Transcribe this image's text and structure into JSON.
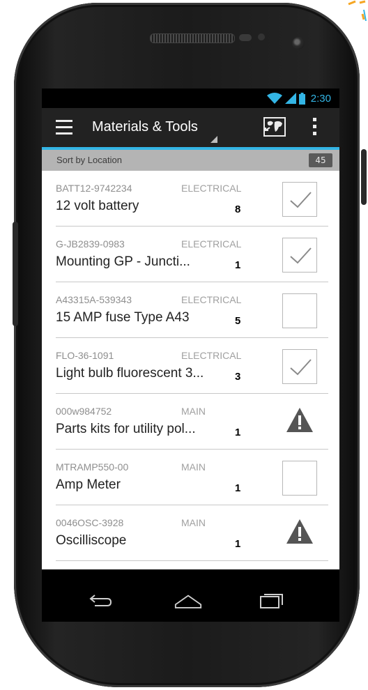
{
  "status_bar": {
    "time": "2:30",
    "icons": [
      "wifi-icon",
      "signal-icon",
      "battery-icon"
    ]
  },
  "action_bar": {
    "title": "Materials & Tools",
    "icons": [
      "menu-icon",
      "map-icon",
      "overflow-menu-icon"
    ]
  },
  "sort_bar": {
    "label": "Sort by Location",
    "count": "45"
  },
  "items": [
    {
      "code": "BATT12-9742234",
      "category": "ELECTRICAL",
      "name": "12 volt battery",
      "qty": "8",
      "status": "checked"
    },
    {
      "code": "G-JB2839-0983",
      "category": "ELECTRICAL",
      "name": "Mounting GP - Juncti...",
      "qty": "1",
      "status": "checked"
    },
    {
      "code": "A43315A-539343",
      "category": "ELECTRICAL",
      "name": "15 AMP fuse Type A43",
      "qty": "5",
      "status": "unchecked"
    },
    {
      "code": "FLO-36-1091",
      "category": "ELECTRICAL",
      "name": "Light bulb fluorescent 3...",
      "qty": "3",
      "status": "checked"
    },
    {
      "code": "000w984752",
      "category": "MAIN",
      "name": "Parts kits for utility pol...",
      "qty": "1",
      "status": "warning"
    },
    {
      "code": "MTRAMP550-00",
      "category": "MAIN",
      "name": "Amp Meter",
      "qty": "1",
      "status": "unchecked"
    },
    {
      "code": "0046OSC-3928",
      "category": "MAIN",
      "name": "Oscilliscope",
      "qty": "1",
      "status": "warning"
    }
  ],
  "nav_bar": {
    "icons": [
      "back-icon",
      "home-icon",
      "recent-apps-icon"
    ]
  },
  "colors": {
    "accent": "#33b5e5",
    "action_bar": "#222222",
    "sort_bar": "#b4b4b4"
  }
}
